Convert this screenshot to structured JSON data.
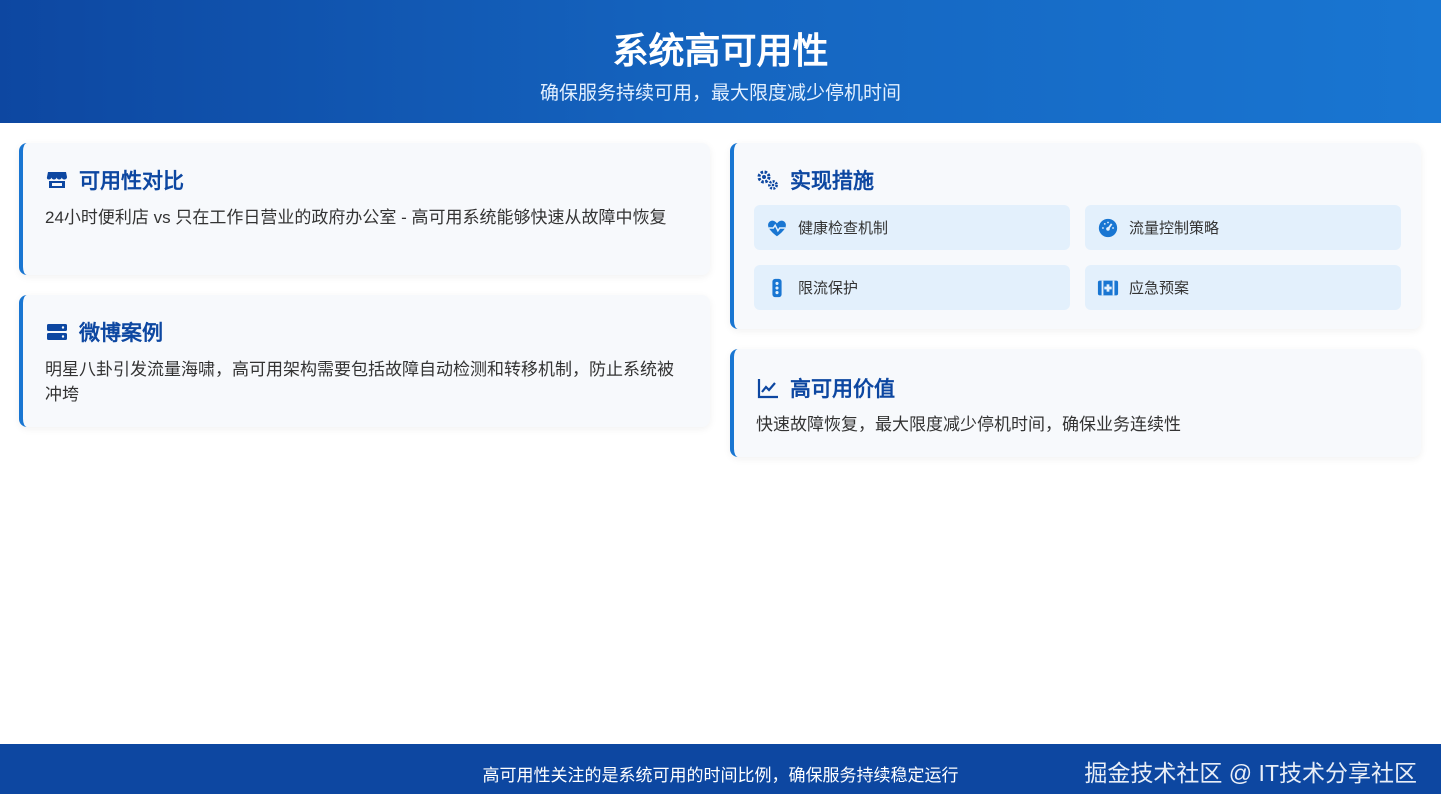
{
  "header": {
    "title": "系统高可用性",
    "subtitle": "确保服务持续可用，最大限度减少停机时间"
  },
  "cards": {
    "availability": {
      "icon": "store-icon",
      "title": "可用性对比",
      "text": "24小时便利店 vs 只在工作日营业的政府办公室 - 高可用系统能够快速从故障中恢复"
    },
    "weibo": {
      "icon": "server-icon",
      "title": "微博案例",
      "text": "明星八卦引发流量海啸，高可用架构需要包括故障自动检测和转移机制，防止系统被冲垮"
    },
    "measures": {
      "icon": "gears-icon",
      "title": "实现措施",
      "items": [
        {
          "icon": "heartbeat-icon",
          "label": "健康检查机制"
        },
        {
          "icon": "gauge-icon",
          "label": "流量控制策略"
        },
        {
          "icon": "traffic-light-icon",
          "label": "限流保护"
        },
        {
          "icon": "first-aid-icon",
          "label": "应急预案"
        }
      ]
    },
    "value": {
      "icon": "line-chart-icon",
      "title": "高可用价值",
      "text": "快速故障恢复，最大限度减少停机时间，确保业务连续性"
    }
  },
  "footer": {
    "text": "高可用性关注的是系统可用的时间比例，确保服务持续稳定运行",
    "watermark": "掘金技术社区 @ IT技术分享社区"
  },
  "colors": {
    "primary": "#0d47a1",
    "accent": "#1976d2",
    "card_bg": "#f7f9fc",
    "chip_bg": "#e3f0fc"
  }
}
